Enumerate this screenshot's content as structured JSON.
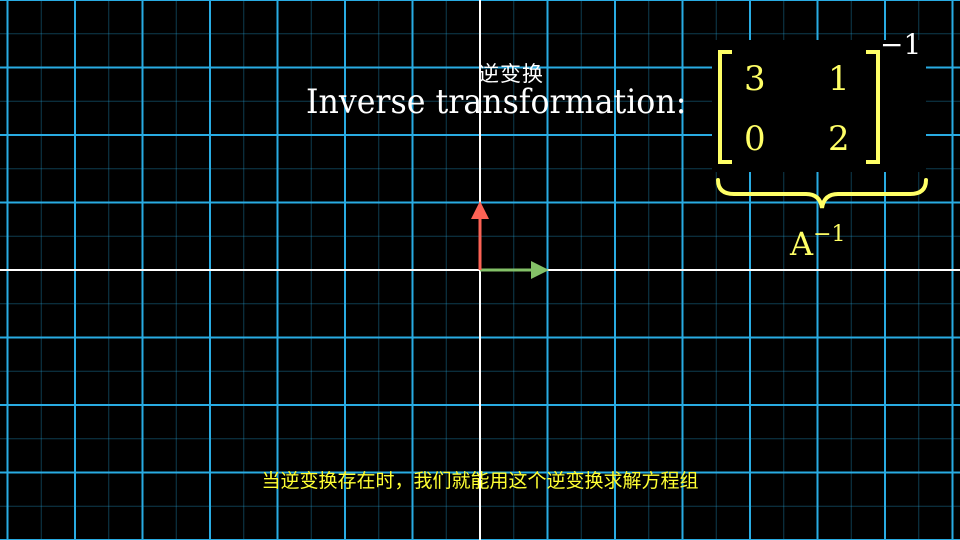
{
  "scene": {
    "background_color": "#000000",
    "grid_color": "#29abe2",
    "axis_color": "#ffffff",
    "label_color": "#ffff66",
    "i_hat_color": "#83c167",
    "j_hat_color": "#fc6255"
  },
  "title": {
    "chinese": "逆变换",
    "english": "Inverse transformation:"
  },
  "matrix": {
    "rows": [
      [
        "3",
        "1"
      ],
      [
        "0",
        "2"
      ]
    ],
    "exponent": "−1",
    "name": "A",
    "name_exponent": "−1"
  },
  "subtitle": "当逆变换存在时，我们就能用这个逆变换求解方程组"
}
